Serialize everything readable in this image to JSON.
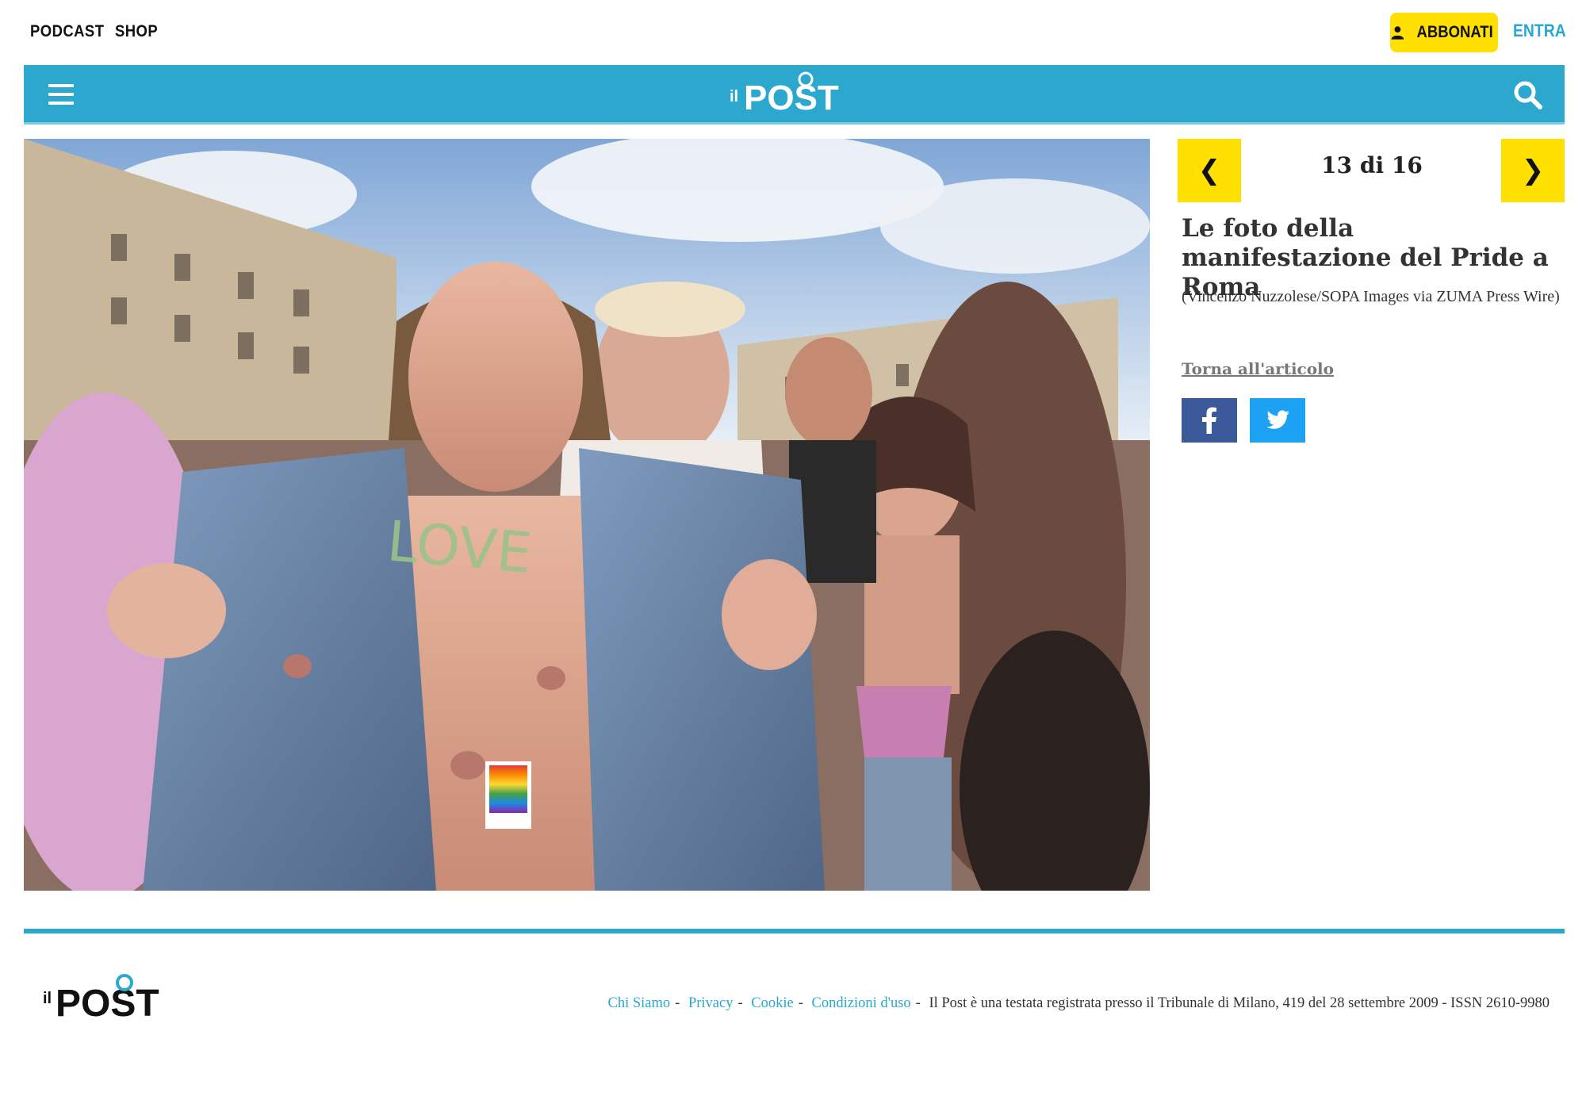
{
  "topbar": {
    "links": [
      "PODCAST",
      "SHOP"
    ],
    "subscribe_label": "ABBONATI",
    "login_label": "ENTRA"
  },
  "header": {
    "logo_small": "il",
    "logo_main": "POST",
    "accent_color": "#2ca7cd"
  },
  "photo": {
    "chest_text": "LOVE"
  },
  "gallery": {
    "counter": "13 di 16",
    "prev_icon": "chevron-left-icon",
    "next_icon": "chevron-right-icon",
    "title": "Le foto della manifestazione del Pride a Roma",
    "credit": "(Vincenzo Nuzzolese/SOPA Images via ZUMA Press Wire)",
    "back_link": "Torna all'articolo"
  },
  "share": {
    "facebook_icon": "facebook-icon",
    "twitter_icon": "twitter-icon"
  },
  "footer": {
    "links": [
      "Chi Siamo",
      "Privacy",
      "Cookie",
      "Condizioni d'uso"
    ],
    "separator": "-",
    "legal": "Il Post è una testata registrata presso il Tribunale di Milano, 419 del 28 settembre 2009 - ISSN 2610-9980"
  }
}
